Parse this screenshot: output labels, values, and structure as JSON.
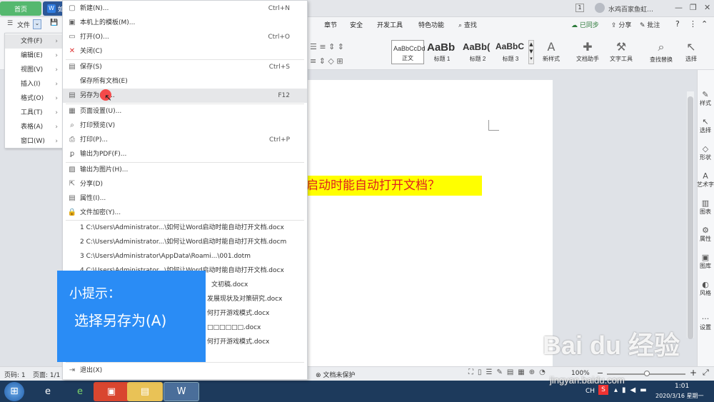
{
  "titlebar": {
    "home_tab": "首页",
    "doc_tab_icon": "W",
    "doc_tab_title": "如",
    "user_name": "水鸡百家鱼虹…",
    "page_badge": "1"
  },
  "menubar": {
    "file_label": "文件",
    "ribbon_tabs": [
      "章节",
      "安全",
      "开发工具",
      "特色功能"
    ],
    "search_label": "查找",
    "sync_label": "已同步",
    "share_label": "分享",
    "comment_label": "批注",
    "help": "?"
  },
  "toolbar": {
    "styles": [
      {
        "preview": "AaBbCcDd",
        "label": "正文"
      },
      {
        "preview": "AaBb",
        "label": "标题 1"
      },
      {
        "preview": "AaBb(",
        "label": "标题 2"
      },
      {
        "preview": "AaBbC",
        "label": "标题 3"
      }
    ],
    "tools": [
      {
        "icon": "new-style-icon",
        "label": "新样式"
      },
      {
        "icon": "doc-assistant-icon",
        "label": "文档助手"
      },
      {
        "icon": "text-tools-icon",
        "label": "文字工具"
      },
      {
        "icon": "find-replace-icon",
        "label": "查找替换"
      },
      {
        "icon": "select-icon",
        "label": "选择"
      }
    ]
  },
  "left_menu": [
    {
      "label": "文件(F)"
    },
    {
      "label": "编辑(E)"
    },
    {
      "label": "视图(V)"
    },
    {
      "label": "插入(I)"
    },
    {
      "label": "格式(O)"
    },
    {
      "label": "工具(T)"
    },
    {
      "label": "表格(A)"
    },
    {
      "label": "窗口(W)"
    }
  ],
  "file_menu": {
    "items": [
      {
        "label": "新建(N)...",
        "shortcut": "Ctrl+N",
        "icon": "new-doc-icon"
      },
      {
        "label": "本机上的模板(M)...",
        "shortcut": "",
        "icon": "template-icon"
      },
      {
        "label": "打开(O)...",
        "shortcut": "Ctrl+O",
        "icon": "open-folder-icon"
      },
      {
        "label": "关闭(C)",
        "shortcut": "",
        "icon": "close-doc-icon"
      },
      {
        "label": "保存(S)",
        "shortcut": "Ctrl+S",
        "icon": "save-icon"
      },
      {
        "label": "保存所有文档(E)",
        "shortcut": "",
        "icon": ""
      },
      {
        "label": "另存为(A)...",
        "shortcut": "F12",
        "icon": "save-as-icon"
      },
      {
        "label": "页面设置(U)...",
        "shortcut": "",
        "icon": "page-setup-icon"
      },
      {
        "label": "打印预览(V)",
        "shortcut": "",
        "icon": "print-preview-icon"
      },
      {
        "label": "打印(P)...",
        "shortcut": "Ctrl+P",
        "icon": "print-icon"
      },
      {
        "label": "输出为PDF(F)...",
        "shortcut": "",
        "icon": "pdf-icon"
      },
      {
        "label": "输出为图片(H)...",
        "shortcut": "",
        "icon": "image-icon"
      },
      {
        "label": "分享(D)",
        "shortcut": "",
        "icon": "share-icon"
      },
      {
        "label": "属性(I)...",
        "shortcut": "",
        "icon": "properties-icon"
      },
      {
        "label": "文件加密(Y)...",
        "shortcut": "",
        "icon": "encrypt-icon"
      }
    ],
    "recent": [
      "1 C:\\Users\\Administrator...\\如何让Word启动时能自动打开文档.docx",
      "2 C:\\Users\\Administrator...\\如何让Word启动时能自动打开文档.docm",
      "3 C:\\Users\\Administrator\\AppData\\Roami...\\001.dotm",
      "4 C:\\Users\\Administrator...\\如何让Word启动时能自动打开文档.docx",
      "文初稿.docx",
      "发展现状及对策研究.docx",
      "何打开游戏模式.docx",
      "□□□□□□.docx",
      "何打开游戏模式.docx"
    ],
    "exit_label": "退出(X)"
  },
  "document": {
    "highlighted_text": "启动时能自动打开文档？"
  },
  "tip": {
    "heading": "小提示：",
    "body": "选择另存为(A)"
  },
  "right_panel": [
    "样式",
    "选择",
    "形状",
    "艺术字",
    "图表",
    "属性",
    "图库",
    "风格",
    "设置"
  ],
  "statusbar": {
    "page_num": "页码: 1",
    "page_count": "页面: 1/1",
    "protect": "文档未保护",
    "zoom": "100%"
  },
  "taskbar": {
    "time": "1:01",
    "date": "2020/3/16 星期一",
    "ime": "CH"
  },
  "watermark": {
    "main": "Bai du 经验",
    "sub": "jingyan.baidu.com"
  }
}
